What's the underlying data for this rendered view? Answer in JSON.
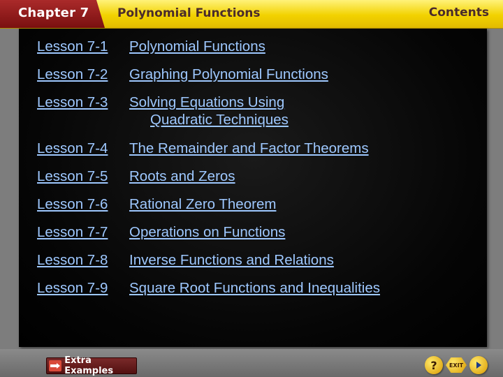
{
  "header": {
    "chapter_label": "Chapter 7",
    "chapter_title": "Polynomial Functions",
    "contents_label": "Contents"
  },
  "lessons": [
    {
      "number": "Lesson 7-1",
      "title": "Polynomial Functions"
    },
    {
      "number": "Lesson 7-2",
      "title": "Graphing Polynomial Functions"
    },
    {
      "number": "Lesson 7-3",
      "title": "Solving Equations Using",
      "title_line2": "Quadratic Techniques"
    },
    {
      "number": "Lesson 7-4",
      "title": "The Remainder and Factor Theorems"
    },
    {
      "number": "Lesson 7-5",
      "title": "Roots and Zeros"
    },
    {
      "number": "Lesson 7-6",
      "title": "Rational Zero Theorem"
    },
    {
      "number": "Lesson 7-7",
      "title": "Operations on Functions"
    },
    {
      "number": "Lesson 7-8",
      "title": "Inverse Functions and Relations"
    },
    {
      "number": "Lesson 7-9",
      "title": "Square Root Functions and Inequalities"
    }
  ],
  "footer": {
    "extra_examples_label": "Extra Examples",
    "help_label": "?",
    "exit_label": "EXIT"
  },
  "colors": {
    "header_yellow": "#f2d200",
    "chapter_tab_red": "#8a1a1a",
    "link_blue": "#9ec8ff",
    "panel_black": "#000000"
  },
  "icons": {
    "extra_examples": "pointing-hand-icon",
    "help": "question-mark-icon",
    "exit": "exit-icon",
    "next": "next-arrow-icon"
  }
}
